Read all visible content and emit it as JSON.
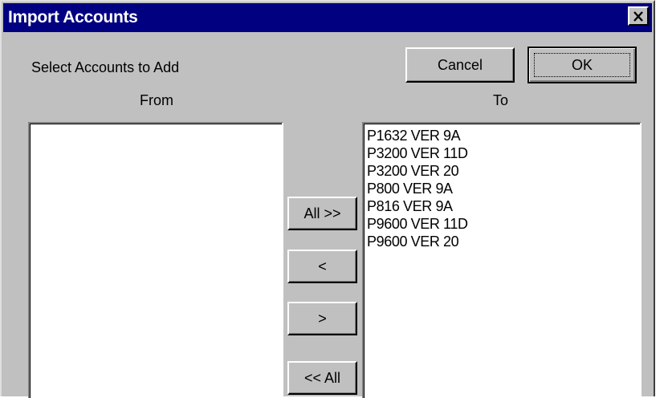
{
  "window": {
    "title": "Import Accounts",
    "close_glyph": "✕"
  },
  "labels": {
    "instruction": "Select Accounts to Add",
    "from": "From",
    "to": "To"
  },
  "buttons": {
    "cancel": "Cancel",
    "ok": "OK",
    "move_all_right": "All >>",
    "move_left": "<",
    "move_right": ">",
    "move_all_left": "<< All"
  },
  "lists": {
    "from_items": [],
    "to_items": [
      "P1632 VER 9A",
      "P3200 VER 11D",
      "P3200 VER 20",
      "P800 VER 9A",
      "P816 VER 9A",
      "P9600 VER 11D",
      "P9600 VER 20"
    ]
  },
  "colors": {
    "titlebar": "#000080",
    "face": "#c0c0c0"
  }
}
